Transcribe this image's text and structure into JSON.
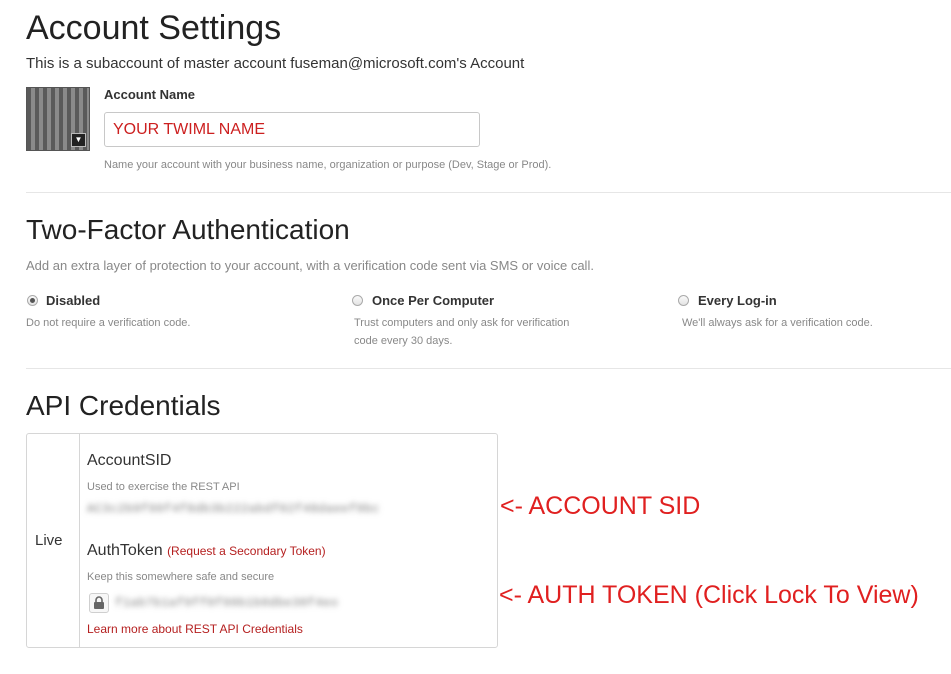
{
  "header": {
    "title": "Account Settings",
    "subtitle": "This is a subaccount of master account fuseman@microsoft.com's Account"
  },
  "account_name": {
    "label": "Account Name",
    "value": "YOUR TWIML NAME",
    "help": "Name your account with your business name, organization or purpose (Dev, Stage or Prod)."
  },
  "two_factor": {
    "title": "Two-Factor Authentication",
    "description": "Add an extra layer of protection to your account, with a verification code sent via SMS or voice call.",
    "options": [
      {
        "label": "Disabled",
        "desc": "Do not require a verification code.",
        "checked": true
      },
      {
        "label": "Once Per Computer",
        "desc_line1": "Trust computers and only ask for verification",
        "desc_line2": "code every 30 days.",
        "checked": false
      },
      {
        "label": "Every Log-in",
        "desc": "We'll always ask for a verification code.",
        "checked": false
      }
    ]
  },
  "api": {
    "title": "API Credentials",
    "env_label": "Live",
    "sid_heading": "AccountSID",
    "sid_help": "Used to exercise the REST API",
    "sid_value_blurred": "AC3c2b9f99f4f8db3b222abdf02f48daeef9bc",
    "token_heading": "AuthToken",
    "token_link": "(Request a Secondary Token)",
    "token_help": "Keep this somewhere safe and secure",
    "token_value_blurred": "f1ab7b1af9ff0f99b1b0dbe30f4eo",
    "learn_more": "Learn more about REST API Credentials"
  },
  "annotations": {
    "sid": "<- ACCOUNT SID",
    "token": "<- AUTH TOKEN (Click Lock To View)"
  },
  "colors": {
    "accent_red": "#b52020",
    "annotation_red": "#e02020"
  },
  "icons": {
    "avatar_menu": "chevron-down-icon",
    "lock": "lock-icon"
  }
}
